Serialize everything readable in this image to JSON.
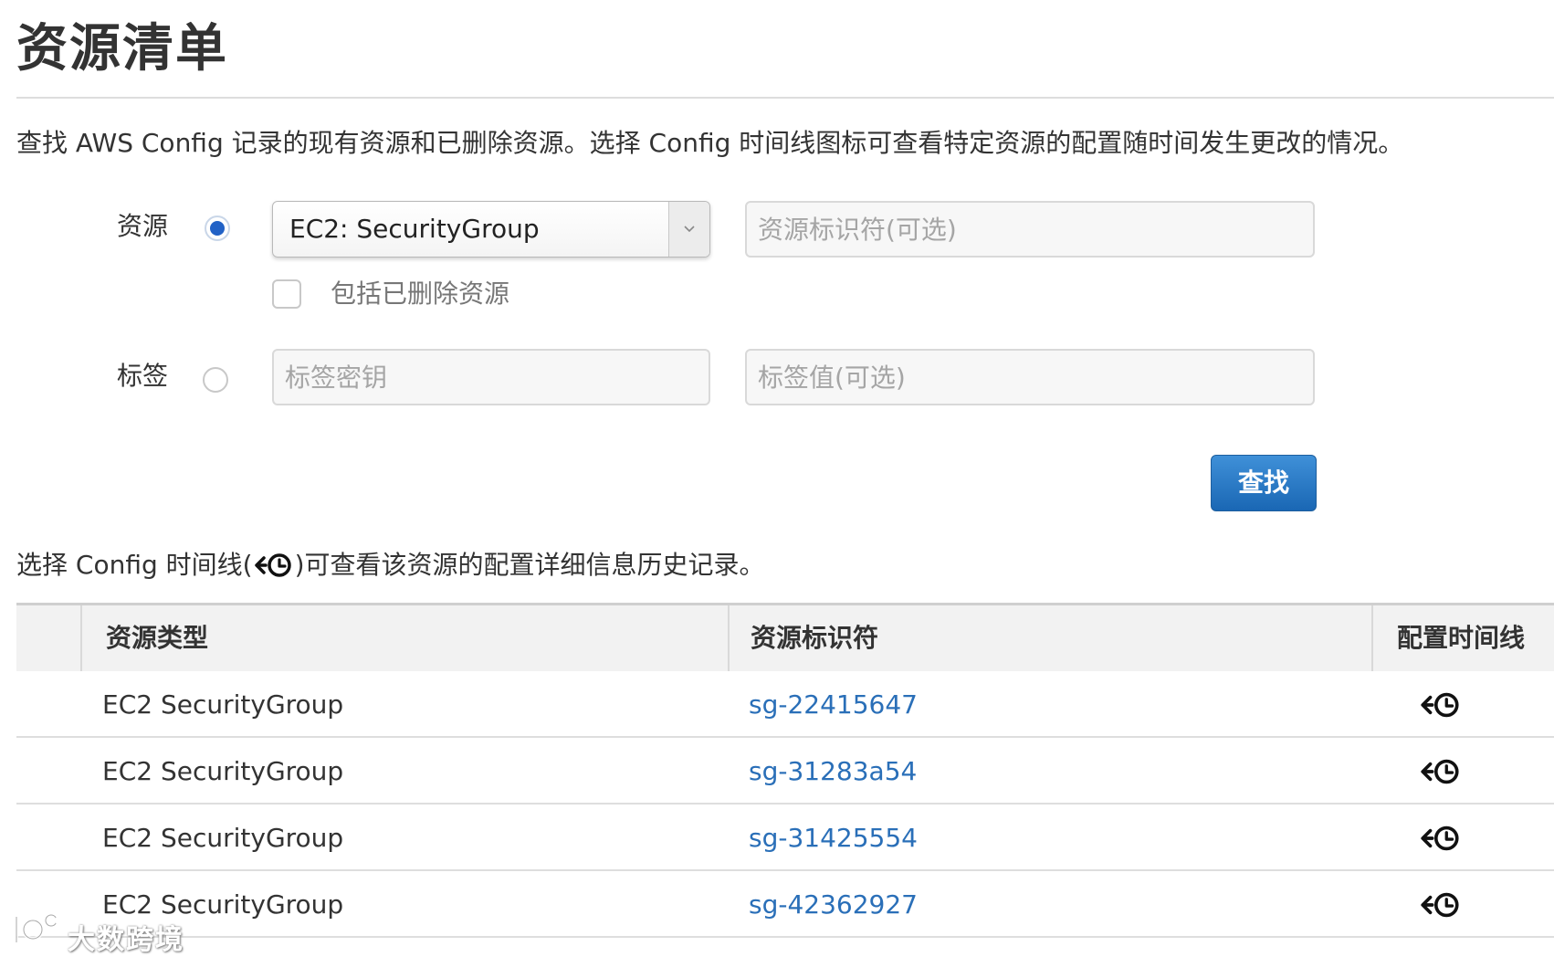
{
  "page": {
    "title": "资源清单"
  },
  "description": "查找 AWS Config 记录的现有资源和已删除资源。选择 Config 时间线图标可查看特定资源的配置随时间发生更改的情况。",
  "form": {
    "resource_label": "资源",
    "resource_radio_selected": true,
    "resource_type_selected": "EC2: SecurityGroup",
    "resource_id_placeholder": "资源标识符(可选)",
    "include_deleted_label": "包括已删除资源",
    "include_deleted_checked": false,
    "tag_label": "标签",
    "tag_radio_selected": false,
    "tag_key_placeholder": "标签密钥",
    "tag_value_placeholder": "标签值(可选)",
    "search_button": "查找"
  },
  "hint": {
    "prefix": "选择 Config 时间线(",
    "suffix": ")可查看该资源的配置详细信息历史记录。"
  },
  "table": {
    "columns": [
      "资源类型",
      "资源标识符",
      "配置时间线"
    ],
    "rows": [
      {
        "type": "EC2 SecurityGroup",
        "id": "sg-22415647"
      },
      {
        "type": "EC2 SecurityGroup",
        "id": "sg-31283a54"
      },
      {
        "type": "EC2 SecurityGroup",
        "id": "sg-31425554"
      },
      {
        "type": "EC2 SecurityGroup",
        "id": "sg-42362927"
      }
    ]
  },
  "icons": {
    "timeline": "timeline-clock-icon",
    "dropdown": "chevron-down-icon",
    "watermark": "watermark-logo"
  },
  "colors": {
    "primary_button": "#1a67b4",
    "link": "#2a6fb8",
    "radio_selected": "#2262c6"
  },
  "watermark": {
    "text": "大数跨境"
  }
}
